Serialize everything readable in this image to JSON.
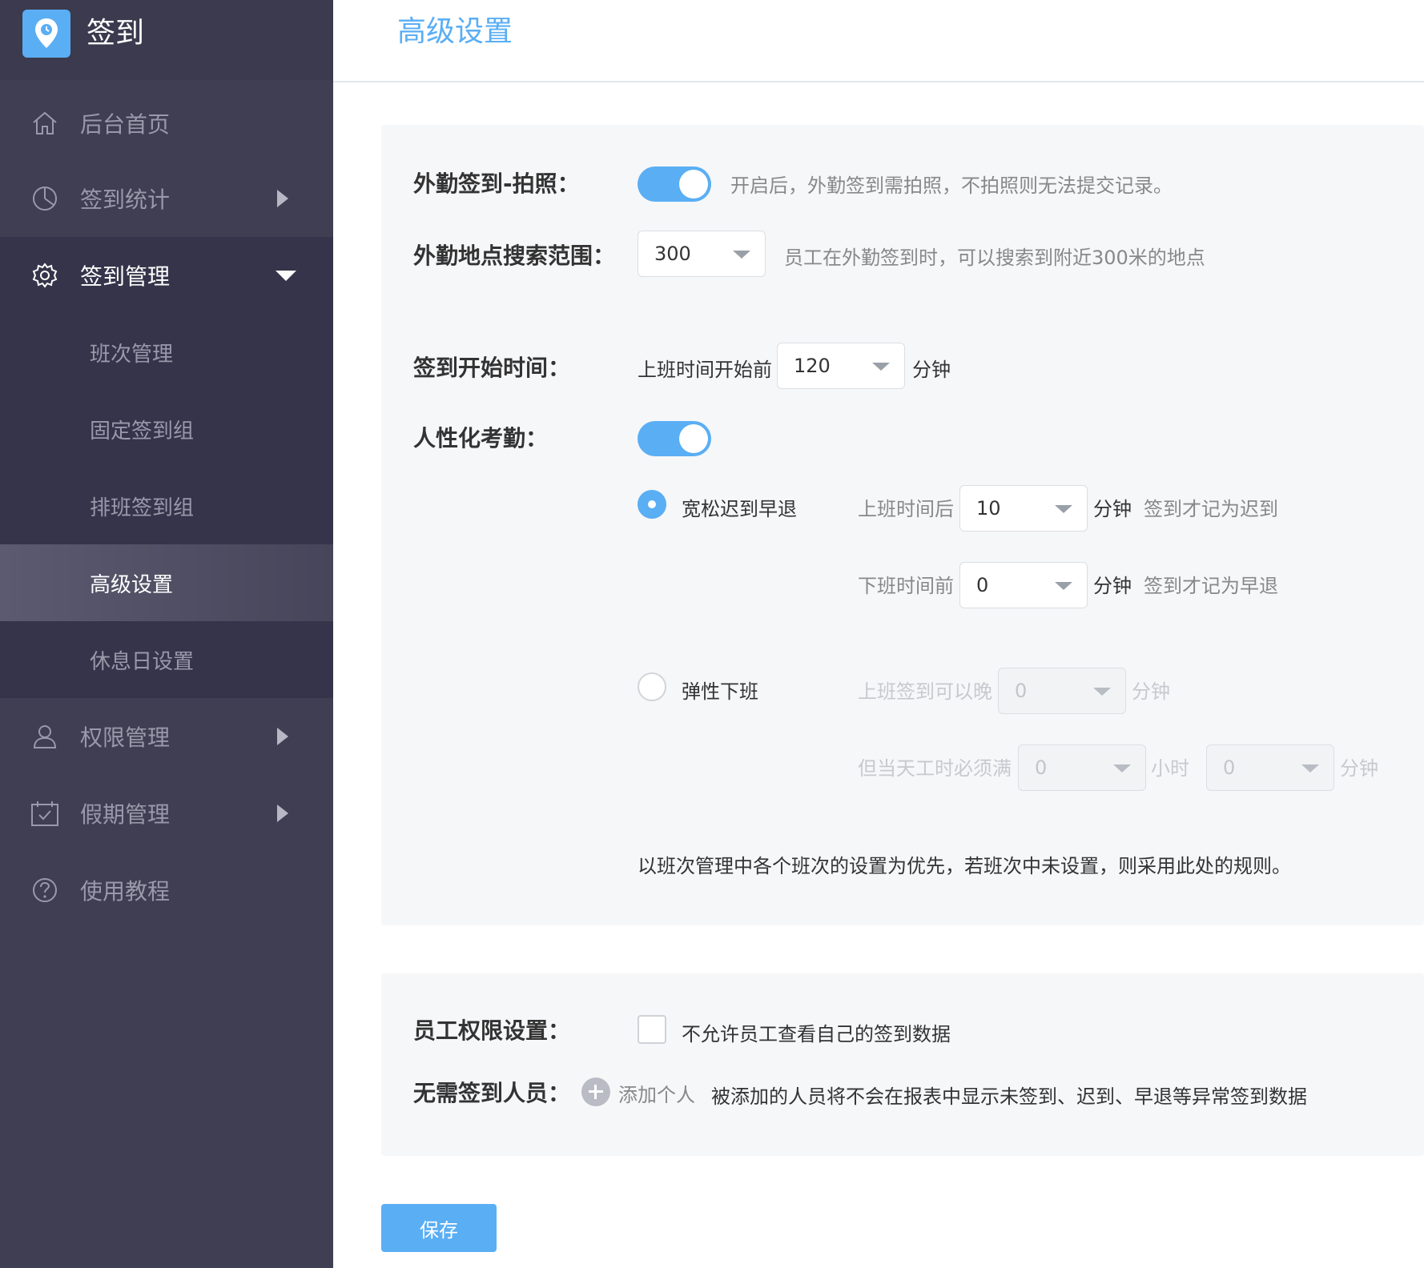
{
  "app": {
    "name": "签到"
  },
  "sidebar": {
    "items": [
      {
        "label": "后台首页",
        "icon": "home-icon"
      },
      {
        "label": "签到统计",
        "icon": "pie-chart-icon"
      },
      {
        "label": "签到管理",
        "icon": "gear-icon"
      },
      {
        "label": "权限管理",
        "icon": "user-icon"
      },
      {
        "label": "假期管理",
        "icon": "calendar-check-icon"
      },
      {
        "label": "使用教程",
        "icon": "help-circle-icon"
      }
    ],
    "submenu": [
      {
        "label": "班次管理"
      },
      {
        "label": "固定签到组"
      },
      {
        "label": "排班签到组"
      },
      {
        "label": "高级设置",
        "active": true
      },
      {
        "label": "休息日设置"
      }
    ]
  },
  "header": {
    "title": "高级设置"
  },
  "settings": {
    "photo": {
      "label": "外勤签到-拍照：",
      "enabled": true,
      "hint": "开启后，外勤签到需拍照，不拍照则无法提交记录。"
    },
    "range": {
      "label": "外勤地点搜索范围：",
      "value": "300",
      "hint": "员工在外勤签到时，可以搜索到附近300米的地点"
    },
    "start": {
      "label": "签到开始时间：",
      "prefix": "上班时间开始前",
      "value": "120",
      "unit": "分钟"
    },
    "humane": {
      "label": "人性化考勤：",
      "enabled": true
    },
    "lenient": {
      "label": "宽松迟到早退",
      "selected": true,
      "late_prefix": "上班时间后",
      "late_value": "10",
      "late_unit": "分钟",
      "late_hint": "签到才记为迟到",
      "early_prefix": "下班时间前",
      "early_value": "0",
      "early_unit": "分钟",
      "early_hint": "签到才记为早退"
    },
    "flexible": {
      "label": "弹性下班",
      "selected": false,
      "late_prefix": "上班签到可以晚",
      "late_value": "0",
      "late_unit": "分钟",
      "hours_prefix": "但当天工时必须满",
      "hours_value": "0",
      "hours_unit": "小时",
      "min_value": "0",
      "min_unit": "分钟"
    },
    "priority_note": "以班次管理中各个班次的设置为优先，若班次中未设置，则采用此处的规则。",
    "permission": {
      "label": "员工权限设置：",
      "checkbox_label": "不允许员工查看自己的签到数据",
      "checked": false
    },
    "exempt": {
      "label": "无需签到人员：",
      "add_label": "添加个人",
      "hint": "被添加的人员将不会在报表中显示未签到、迟到、早退等异常签到数据"
    }
  },
  "actions": {
    "save": "保存"
  },
  "colors": {
    "accent": "#5aaef4",
    "sidebar": "#3f3e52"
  }
}
